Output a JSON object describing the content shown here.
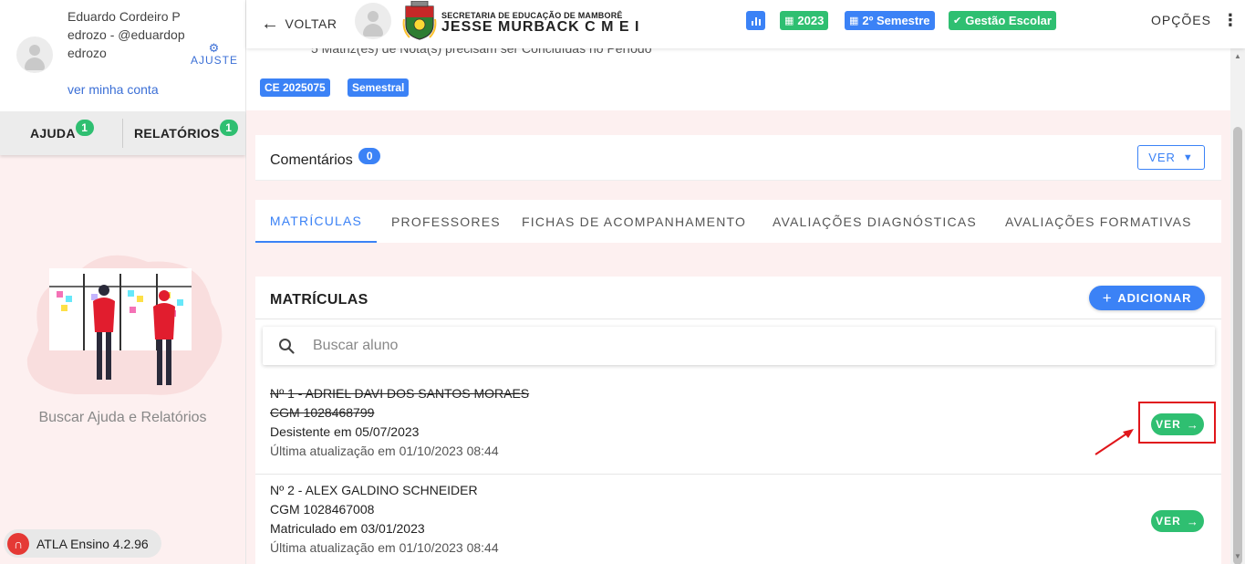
{
  "user": {
    "name": "Eduardo Cordeiro Pedrozo - @eduardopedrozo",
    "account_link": "ver minha conta",
    "adjust_label": "AJUSTE"
  },
  "sidebar": {
    "tabs": [
      {
        "label": "AJUDA",
        "badge": "1"
      },
      {
        "label": "RELATÓRIOS",
        "badge": "1"
      }
    ],
    "help_caption": "Buscar Ajuda e Relatórios",
    "version": "ATLA Ensino 4.2.96"
  },
  "header": {
    "back_label": "VOLTAR",
    "school_subtitle": "SECRETARIA DE EDUCAÇÃO DE MAMBORÊ",
    "school_name": "JESSE MURBACK C M E I",
    "chips": {
      "year": "2023",
      "semester": "2º Semestre",
      "gestao": "Gestão Escolar"
    },
    "options_label": "OPÇÕES"
  },
  "summary": {
    "pending_text": "5 Matriz(es) de Nota(s) precisam ser Concluídas no Período",
    "chips": [
      "CE 2025075",
      "Semestral"
    ]
  },
  "comments": {
    "title": "Comentários",
    "count": "0",
    "view_label": "VER"
  },
  "tabs": [
    {
      "label": "MATRÍCULAS",
      "active": true
    },
    {
      "label": "PROFESSORES",
      "active": false
    },
    {
      "label": "FICHAS DE ACOMPANHAMENTO",
      "active": false
    },
    {
      "label": "AVALIAÇÕES DIAGNÓSTICAS",
      "active": false
    },
    {
      "label": "AVALIAÇÕES FORMATIVAS",
      "active": false
    }
  ],
  "enrollments": {
    "title": "MATRÍCULAS",
    "add_label": "ADICIONAR",
    "search_placeholder": "Buscar aluno",
    "view_label": "VER",
    "students": [
      {
        "name_line": "Nº 1 - ADRIEL DAVI DOS SANTOS MORAES",
        "cgm": "CGM 1028468799",
        "status": "Desistente em 05/07/2023",
        "updated": "Última atualização em 01/10/2023 08:44"
      },
      {
        "name_line": "Nº 2 - ALEX GALDINO SCHNEIDER",
        "cgm": "CGM 1028467008",
        "status": "Matriculado em 03/01/2023",
        "updated": "Última atualização em 01/10/2023 08:44"
      }
    ]
  },
  "colors": {
    "primary_blue": "#3b82f6",
    "success_green": "#2fbf71",
    "annotation_red": "#e0161b",
    "sidebar_bg": "#fdf0f0"
  }
}
